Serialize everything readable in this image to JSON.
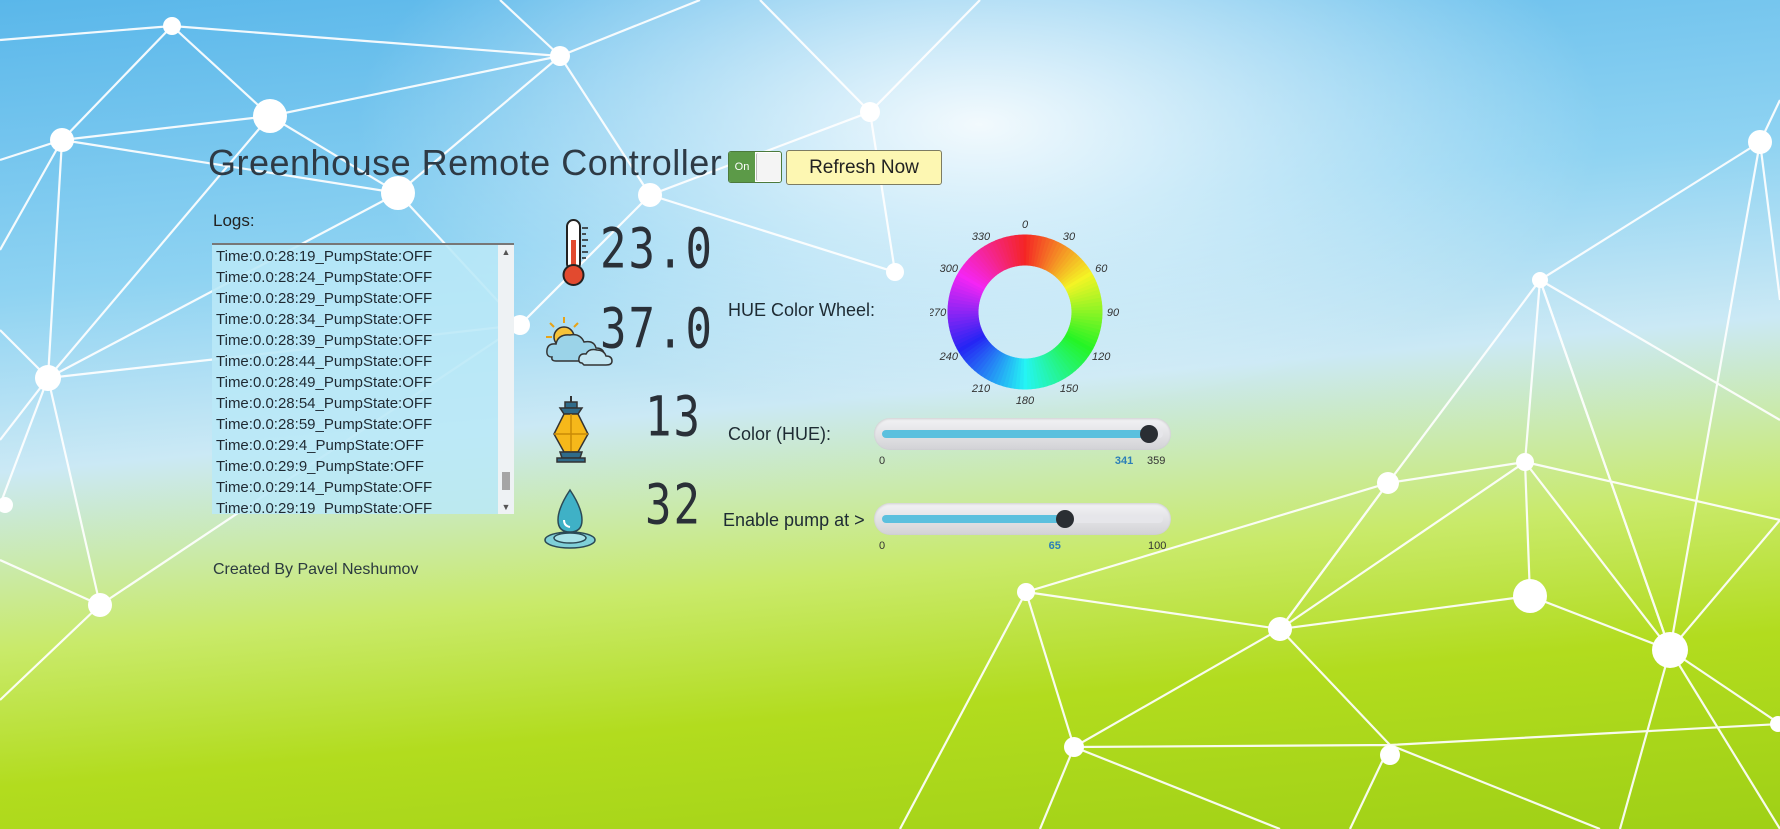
{
  "header": {
    "title": "Greenhouse Remote Controller",
    "toggle_label": "On",
    "refresh_label": "Refresh Now"
  },
  "logs": {
    "label": "Logs:",
    "lines": [
      "Time:0.0:28:19_PumpState:OFF",
      "Time:0.0:28:24_PumpState:OFF",
      "Time:0.0:28:29_PumpState:OFF",
      "Time:0.0:28:34_PumpState:OFF",
      "Time:0.0:28:39_PumpState:OFF",
      "Time:0.0:28:44_PumpState:OFF",
      "Time:0.0:28:49_PumpState:OFF",
      "Time:0.0:28:54_PumpState:OFF",
      "Time:0.0:28:59_PumpState:OFF",
      "Time:0.0:29:4_PumpState:OFF",
      "Time:0.0:29:9_PumpState:OFF",
      "Time:0.0:29:14_PumpState:OFF",
      "Time:0.0:29:19_PumpState:OFF"
    ]
  },
  "credit": "Created By Pavel Neshumov",
  "readings": {
    "temperature": "23.0",
    "ambient": "37.0",
    "light": "13",
    "water": "32"
  },
  "icons": {
    "temperature": "thermometer-icon",
    "ambient": "sun-cloud-icon",
    "light": "lantern-icon",
    "water": "water-drop-icon"
  },
  "hue_wheel": {
    "label": "HUE Color Wheel:",
    "ticks": [
      "0",
      "30",
      "60",
      "90",
      "120",
      "150",
      "180",
      "210",
      "240",
      "270",
      "300",
      "330"
    ]
  },
  "color_slider": {
    "label": "Color (HUE):",
    "min": "0",
    "max": "359",
    "value": "341"
  },
  "pump_slider": {
    "label": "Enable pump at >",
    "min": "0",
    "max": "100",
    "value": "65"
  },
  "colors": {
    "toggle_on": "#5c9a48",
    "refresh_bg": "#fdf7b2",
    "slider_fill": "#5bc0de",
    "slider_thumb": "#2a2e33",
    "slider_value": "#2c7fb8"
  }
}
